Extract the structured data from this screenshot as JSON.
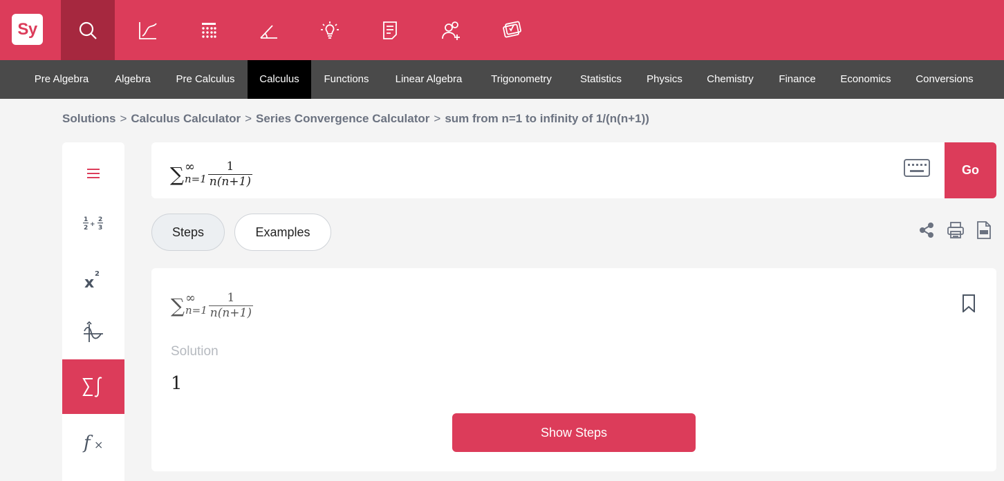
{
  "brand": {
    "logo_text": "Sy",
    "accent": "#dc3c5a",
    "accent_dark": "#a6283f"
  },
  "top_toolbar": [
    {
      "icon": "search-icon",
      "active": true
    },
    {
      "icon": "graph-icon"
    },
    {
      "icon": "calculator-icon"
    },
    {
      "icon": "geometry-icon"
    },
    {
      "icon": "lightbulb-icon"
    },
    {
      "icon": "notebook-icon"
    },
    {
      "icon": "groups-icon"
    },
    {
      "icon": "practice-icon"
    }
  ],
  "subjects": [
    {
      "label": "Pre Algebra"
    },
    {
      "label": "Algebra"
    },
    {
      "label": "Pre Calculus"
    },
    {
      "label": "Calculus",
      "active": true
    },
    {
      "label": "Functions"
    },
    {
      "label": "Linear Algebra"
    },
    {
      "label": "Trigonometry"
    },
    {
      "label": "Statistics"
    },
    {
      "label": "Physics"
    },
    {
      "label": "Chemistry"
    },
    {
      "label": "Finance"
    },
    {
      "label": "Economics"
    },
    {
      "label": "Conversions"
    }
  ],
  "breadcrumb": {
    "items": [
      "Solutions",
      "Calculus Calculator",
      "Series Convergence Calculator",
      "sum from n=1 to infinity of 1/(n(n+1))"
    ],
    "separator": ">"
  },
  "side_tools": [
    {
      "icon": "menu-icon"
    },
    {
      "icon": "fractions-icon"
    },
    {
      "icon": "exponent-icon"
    },
    {
      "icon": "trig-graph-icon"
    },
    {
      "icon": "sum-integral-icon",
      "active": true
    },
    {
      "icon": "function-icon"
    }
  ],
  "expression": {
    "sigma": "∑",
    "upper": "∞",
    "lower": "n=1",
    "numerator": "1",
    "denominator": "n(n+1)"
  },
  "input": {
    "go_label": "Go",
    "keyboard_icon": "keyboard-icon"
  },
  "tabs": {
    "steps_label": "Steps",
    "examples_label": "Examples"
  },
  "actions": [
    "share-icon",
    "print-icon",
    "pdf-icon"
  ],
  "result": {
    "solution_label": "Solution",
    "solution_value": "1",
    "show_steps_label": "Show Steps",
    "bookmark_icon": "bookmark-icon"
  }
}
